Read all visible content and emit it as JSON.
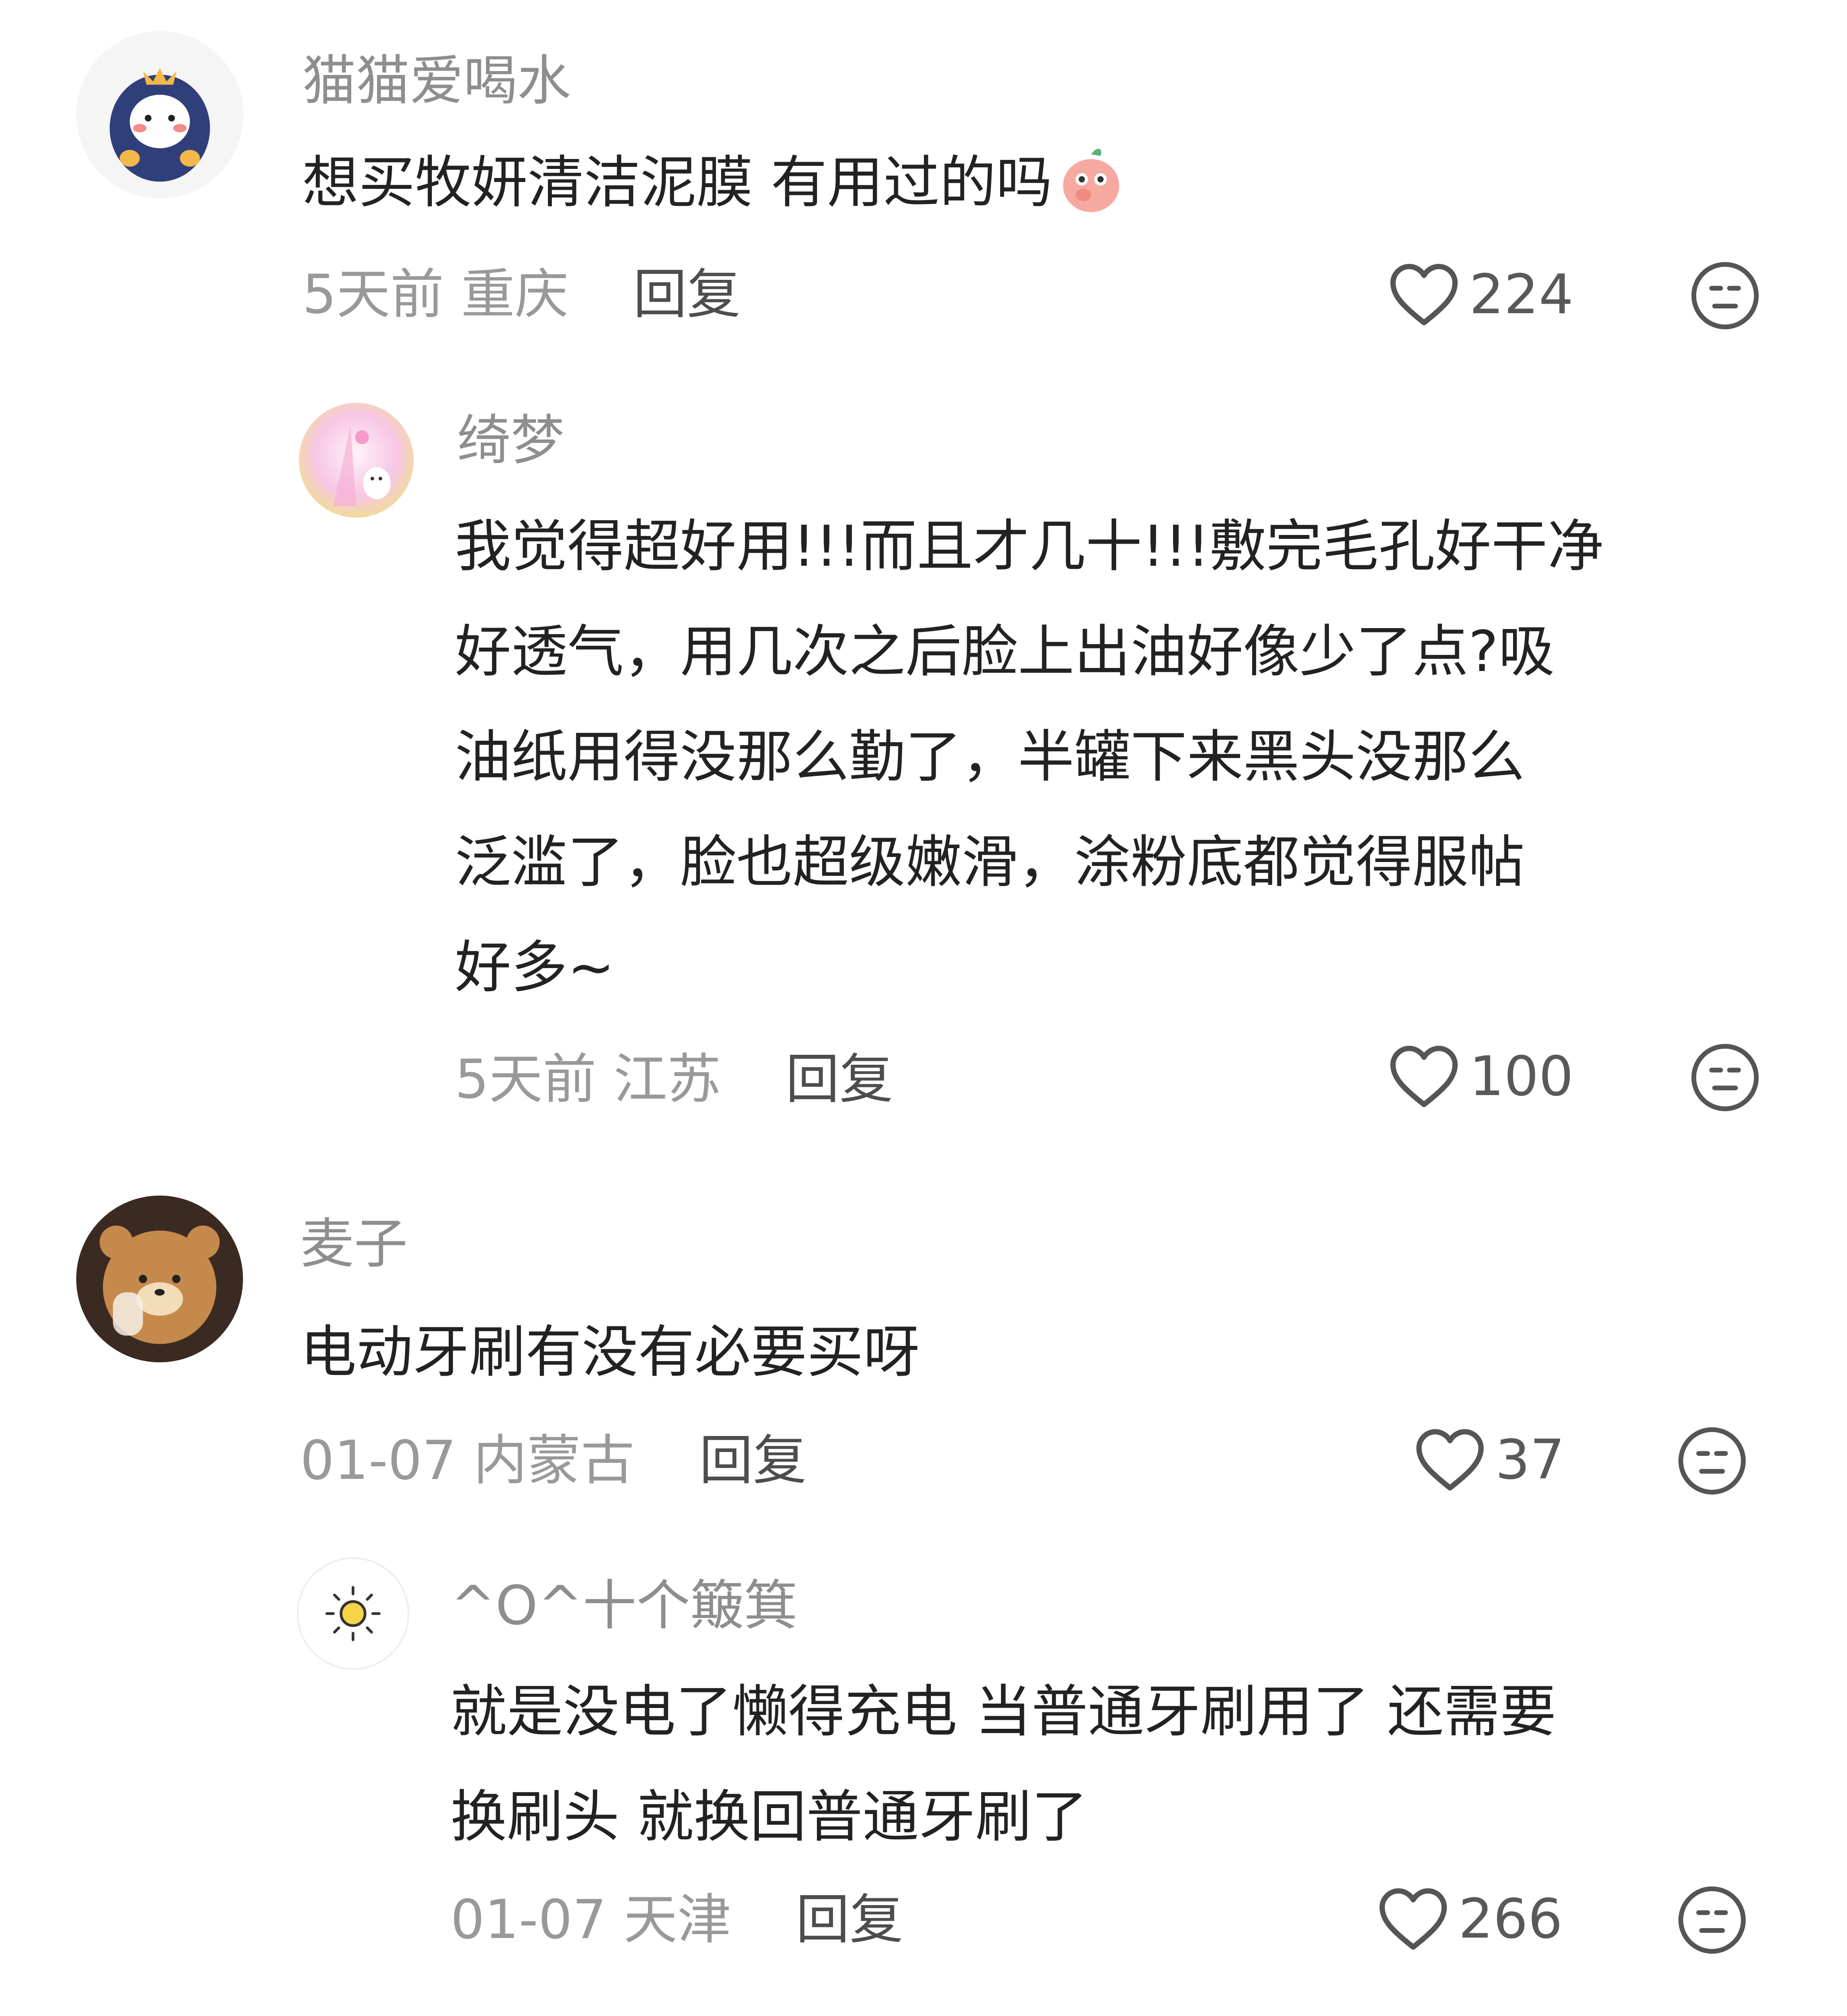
{
  "comments": [
    {
      "username": "猫猫爱喝水",
      "lines": [
        "想买牧妍清洁泥膜 有用过的吗"
      ],
      "time": "5天前",
      "location": "重庆",
      "reply": "回复",
      "likes": "224",
      "icons": {
        "avatar": "cartoon-penguin-avatar",
        "emoji": "peach-shy-emoji"
      }
    },
    {
      "username": "绮梦",
      "lines": [
        "我觉得超好用!!!而且才几十!!!敷完毛孔好干净",
        "好透气，用几次之后脸上出油好像少了点?吸",
        "油纸用得没那么勤了，半罐下来黑头没那么",
        "泛滥了，脸也超级嫩滑，涂粉底都觉得服帖",
        "好多~"
      ],
      "time": "5天前",
      "location": "江苏",
      "reply": "回复",
      "likes": "100",
      "icons": {
        "avatar": "pastel-illustration-avatar"
      }
    },
    {
      "username": "麦子",
      "lines": [
        "电动牙刷有没有必要买呀"
      ],
      "time": "01-07",
      "location": "内蒙古",
      "reply": "回复",
      "likes": "37",
      "icons": {
        "avatar": "brown-bear-avatar"
      }
    },
    {
      "username": "^O^十个簸箕",
      "lines": [
        "就是没电了懒得充电  当普通牙刷用了  还需要",
        "换刷头   就换回普通牙刷了"
      ],
      "time": "01-07",
      "location": "天津",
      "reply": "回复",
      "likes": "266",
      "icons": {
        "avatar": "sun-icon-avatar"
      }
    }
  ],
  "icons": {
    "like": "heart-outline-icon",
    "dislike": "meh-face-icon"
  },
  "colors": {
    "text": "#222222",
    "muted": "#999999",
    "username": "#8e8e8e"
  }
}
